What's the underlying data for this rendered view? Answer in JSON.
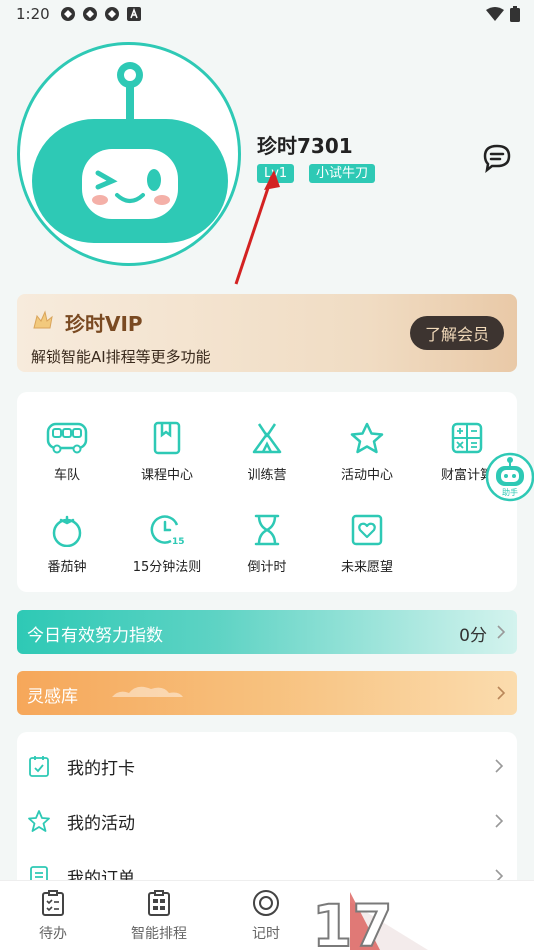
{
  "status_bar": {
    "time": "1:20"
  },
  "profile": {
    "username": "珍时7301",
    "level_badge": "Lv1",
    "title_badge": "小试牛刀"
  },
  "vip": {
    "title": "珍时VIP",
    "subtitle": "解锁智能AI排程等更多功能",
    "button": "了解会员"
  },
  "features": [
    {
      "label": "车队",
      "icon": "bus-icon"
    },
    {
      "label": "课程中心",
      "icon": "book-icon"
    },
    {
      "label": "训练营",
      "icon": "tent-icon"
    },
    {
      "label": "活动中心",
      "icon": "star-icon"
    },
    {
      "label": "财富计算",
      "icon": "calculator-icon"
    },
    {
      "label": "番茄钟",
      "icon": "tomato-icon"
    },
    {
      "label": "15分钟法则",
      "icon": "timer-15-icon"
    },
    {
      "label": "倒计时",
      "icon": "hourglass-icon"
    },
    {
      "label": "未来愿望",
      "icon": "heart-card-icon"
    }
  ],
  "assistant": {
    "label": "助手"
  },
  "effort": {
    "title": "今日有效努力指数",
    "value": "0分"
  },
  "inspiration": {
    "title": "灵感库"
  },
  "list": [
    {
      "label": "我的打卡",
      "icon": "calendar-check-icon"
    },
    {
      "label": "我的活动",
      "icon": "star-outline-icon"
    },
    {
      "label": "我的订单",
      "icon": "document-icon"
    }
  ],
  "bottom_nav": [
    {
      "label": "待办",
      "icon": "checklist-icon"
    },
    {
      "label": "智能排程",
      "icon": "schedule-icon"
    },
    {
      "label": "记时",
      "icon": "target-icon"
    }
  ],
  "colors": {
    "accent": "#2ec9b5",
    "vip_dark": "#3d3430",
    "orange": "#f6a75a"
  }
}
